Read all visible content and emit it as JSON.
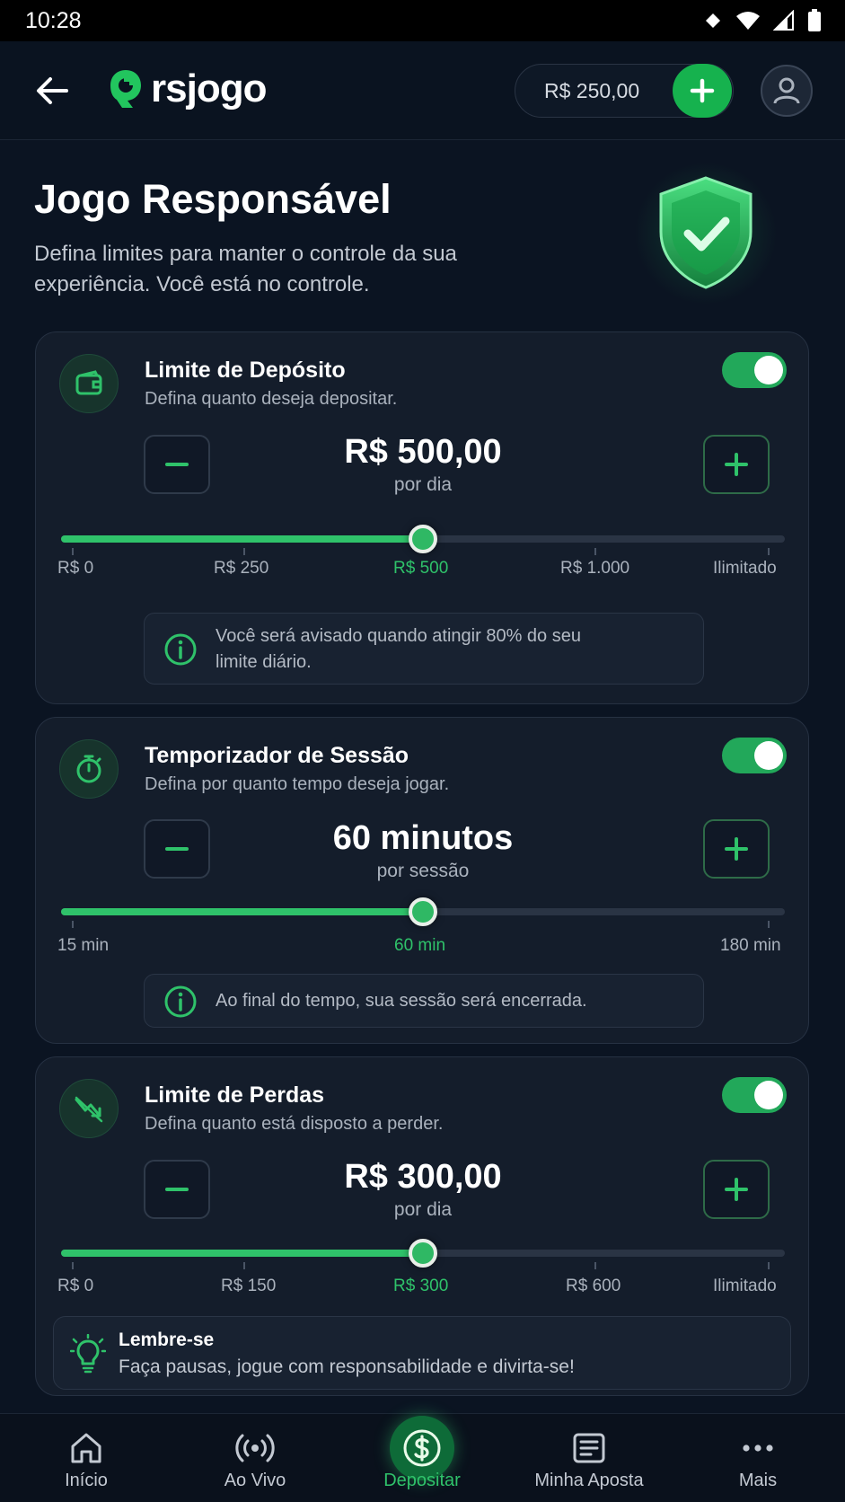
{
  "status_bar": {
    "time": "10:28"
  },
  "app_bar": {
    "logo_text": "rsjogo",
    "balance": "R$ 250,00"
  },
  "header": {
    "title": "Jogo Responsável",
    "subtitle": "Defina limites para manter o controle da sua experiência. Você está no controle."
  },
  "colors": {
    "background": "#0b1422",
    "card": "#141d2b",
    "accent": "#2fc26a",
    "toggle_on": "#22a85a"
  },
  "deposit_limit": {
    "title": "Limite de Depósito",
    "description": "Defina quanto deseja depositar.",
    "enabled": true,
    "value": "R$ 500,00",
    "period": "por dia",
    "slider_value": 0.5,
    "ticks": [
      "R$ 0",
      "R$ 250",
      "R$ 500",
      "R$ 1.000",
      "Ilimitado"
    ],
    "info": "Você será avisado quando atingir 80% do seu limite diário.",
    "icon": "wallet-icon"
  },
  "session_timer": {
    "title": "Temporizador de Sessão",
    "description": "Defina por quanto tempo deseja jogar.",
    "enabled": true,
    "value": "60 minutos",
    "period": "por sessão",
    "slider_value": 0.5,
    "ticks": [
      "15 min",
      "60 min",
      "180 min"
    ],
    "info": "Ao final do tempo, sua sessão será encerrada.",
    "icon": "stopwatch-icon"
  },
  "loss_limit": {
    "title": "Limite de Perdas",
    "description": "Defina quanto está disposto a perder.",
    "enabled": true,
    "value": "R$ 300,00",
    "period": "por dia",
    "slider_value": 0.5,
    "ticks": [
      "R$ 0",
      "R$ 150",
      "R$ 300",
      "R$ 600",
      "Ilimitado"
    ],
    "icon": "trending-down-icon"
  },
  "reminder": {
    "title": "Lembre-se",
    "text": "Faça pausas, jogue com responsabilidade e divirta-se!",
    "icon": "lightbulb-icon"
  },
  "bottom_nav": {
    "items": [
      {
        "label": "Início",
        "icon": "home-icon"
      },
      {
        "label": "Ao Vivo",
        "icon": "live-broadcast-icon"
      },
      {
        "label": "Depositar",
        "icon": "dollar-coin-icon",
        "active": true
      },
      {
        "label": "Minha Aposta",
        "icon": "bet-slip-icon"
      },
      {
        "label": "Mais",
        "icon": "more-dots-icon"
      }
    ]
  }
}
